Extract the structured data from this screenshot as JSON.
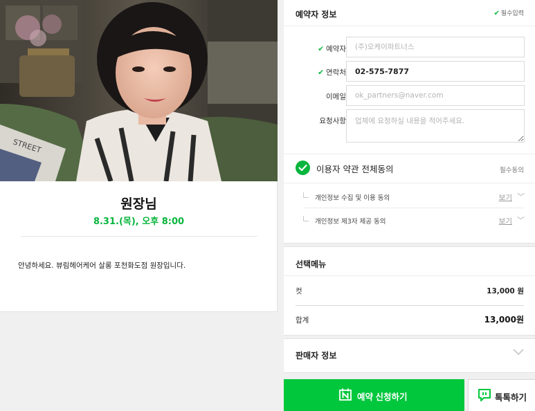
{
  "profile": {
    "name": "원장님",
    "datetime": "8.31.(목), 오후 8:00",
    "description": "안녕하세요. 뷰림헤어케어 살롱 포천화도점 원장입니다.",
    "photo_shirt_text": "STREET"
  },
  "booker": {
    "title": "예약자 정보",
    "required_note": "필수입력",
    "fields": {
      "name_label": "예약자",
      "name_placeholder": "(주)오케이파트너스",
      "phone_label": "연락처",
      "phone_value": "02-575-7877",
      "email_label": "이메일",
      "email_placeholder": "ok_partners@naver.com",
      "request_label": "요청사항",
      "request_placeholder": "업체에 요청하실 내용을 적어주세요."
    },
    "agree_all_label": "이용자 약관 전체동의",
    "agree_required": "필수동의",
    "sub_agreements": [
      {
        "label": "개인정보 수집 및 이용 동의",
        "view": "보기"
      },
      {
        "label": "개인정보 제3자 제공 동의",
        "view": "보기"
      }
    ]
  },
  "menu": {
    "title": "선택메뉴",
    "item_label": "컷",
    "item_price": "13,000 원",
    "total_label": "합계",
    "total_price": "13,000원"
  },
  "seller": {
    "title": "판매자 정보"
  },
  "actions": {
    "reserve_label": "예약 신청하기",
    "talk_label": "톡톡하기"
  },
  "colors": {
    "accent": "#00c73c",
    "accent_text": "#08b53c"
  }
}
